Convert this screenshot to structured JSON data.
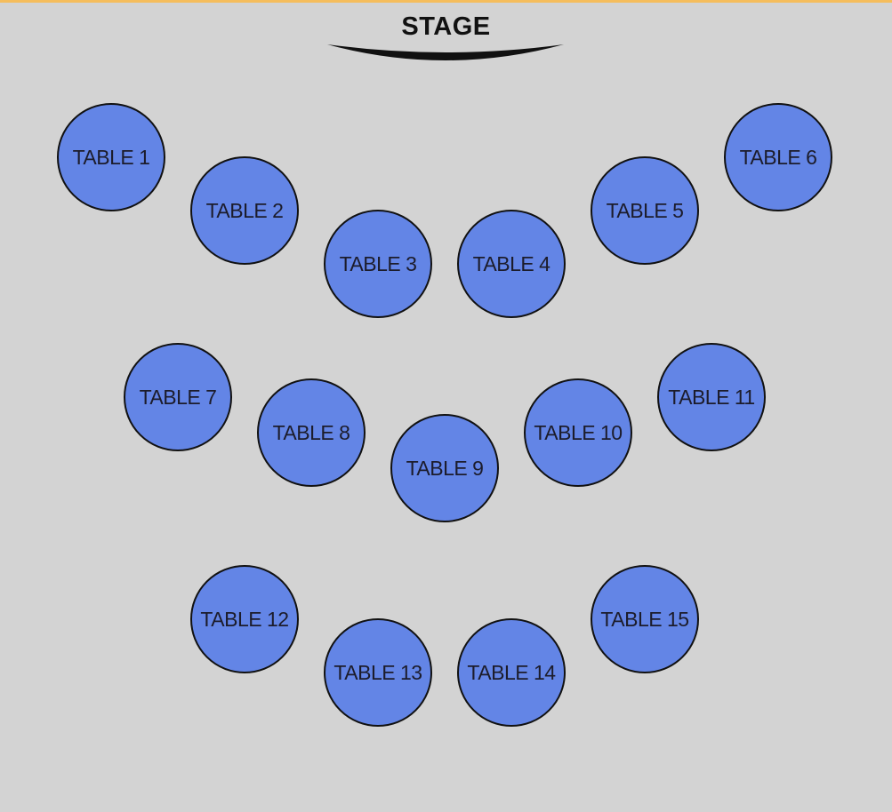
{
  "colors": {
    "background": "#d3d3d3",
    "top_bar": "#f5bd5c",
    "table_fill": "#6385e6",
    "table_border": "#111111",
    "stage_arc": "#111111"
  },
  "stage": {
    "label": "STAGE"
  },
  "tables": [
    {
      "label": "TABLE 1"
    },
    {
      "label": "TABLE 2"
    },
    {
      "label": "TABLE 3"
    },
    {
      "label": "TABLE 4"
    },
    {
      "label": "TABLE 5"
    },
    {
      "label": "TABLE 6"
    },
    {
      "label": "TABLE 7"
    },
    {
      "label": "TABLE 8"
    },
    {
      "label": "TABLE 9"
    },
    {
      "label": "TABLE 10"
    },
    {
      "label": "TABLE 11"
    },
    {
      "label": "TABLE 12"
    },
    {
      "label": "TABLE 13"
    },
    {
      "label": "TABLE 14"
    },
    {
      "label": "TABLE 15"
    }
  ]
}
